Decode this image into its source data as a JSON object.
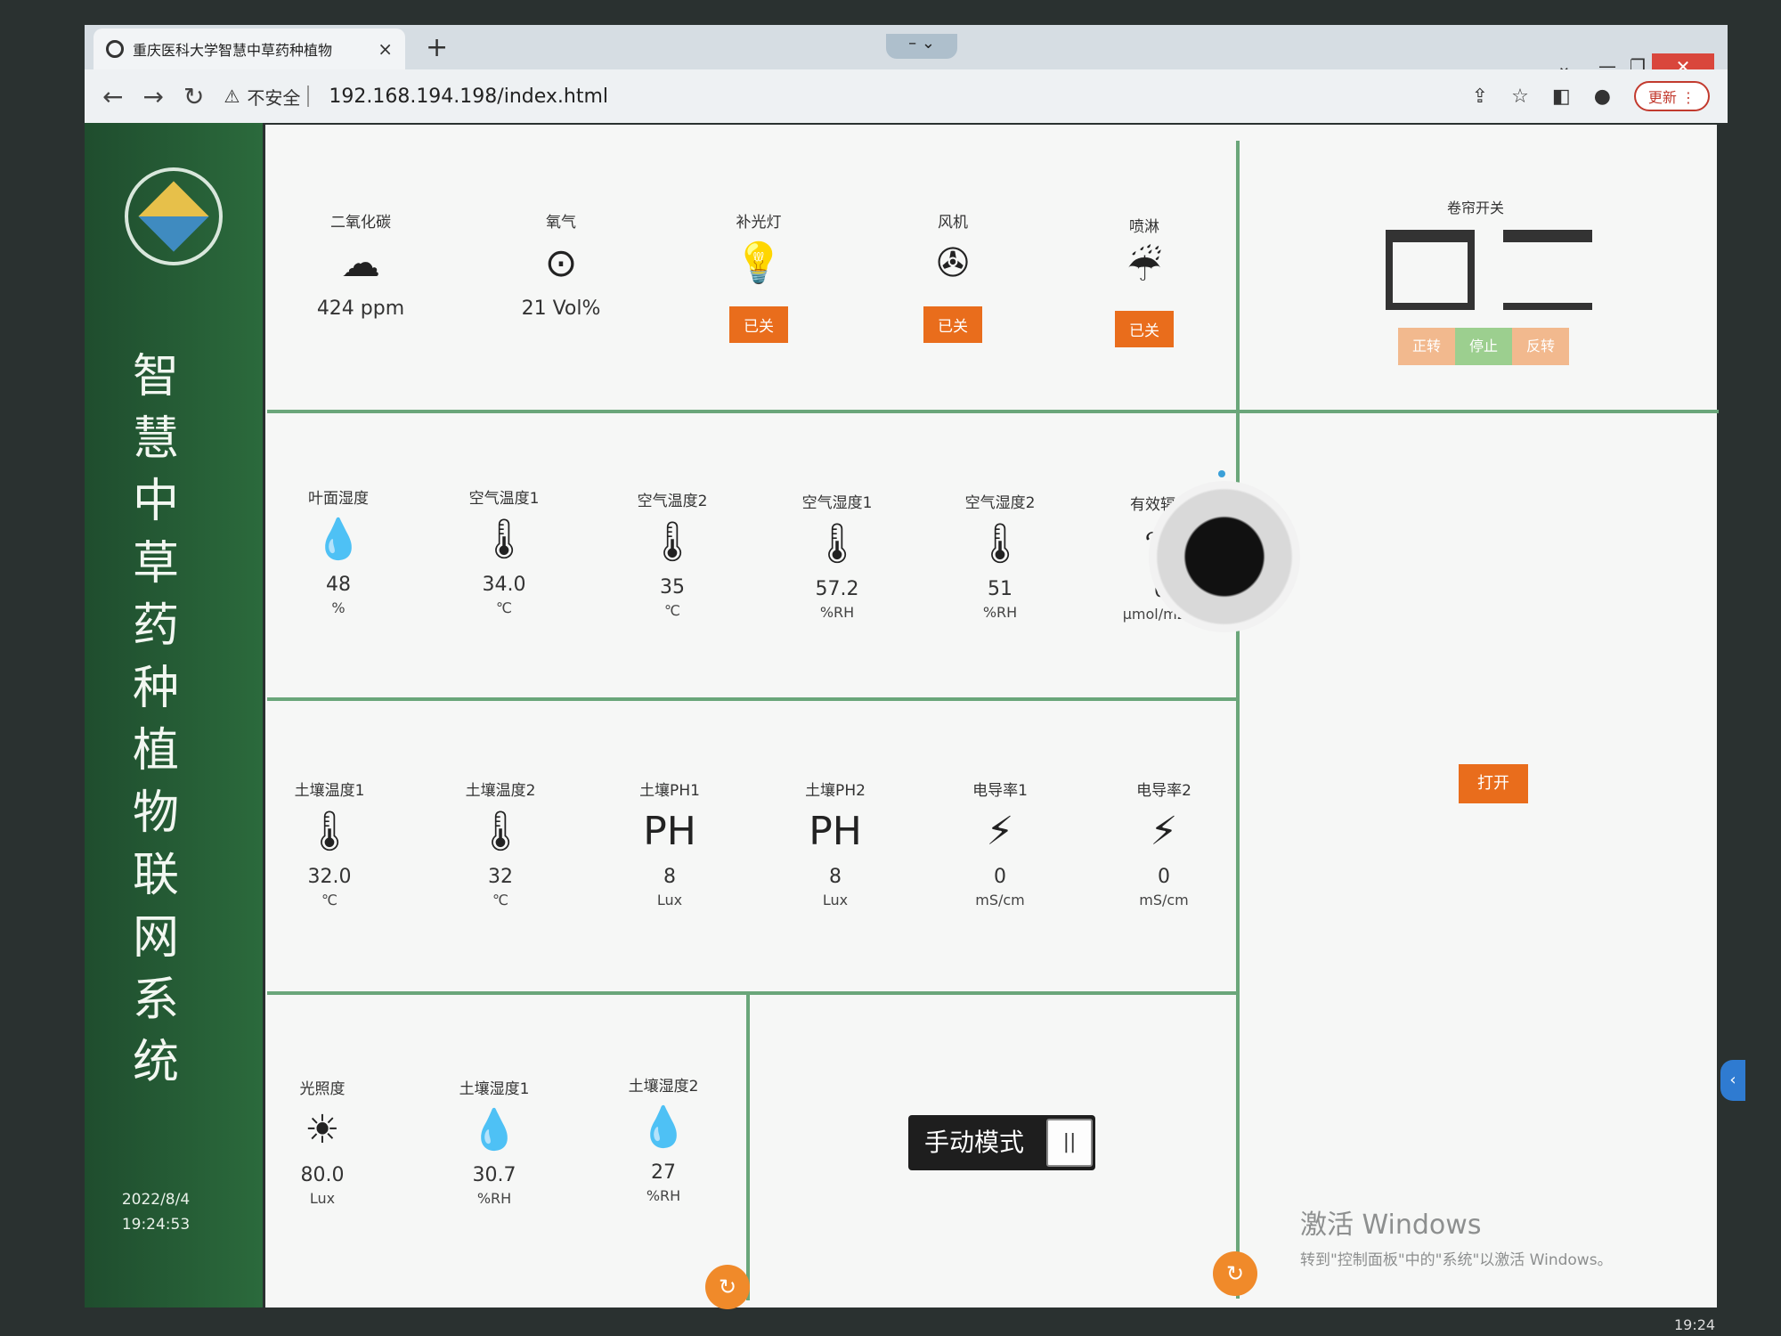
{
  "browser": {
    "tab_title": "重庆医科大学智慧中草药种植物",
    "tab_close": "×",
    "new_tab": "+",
    "address_security": "不安全",
    "address_url": "192.168.194.198/index.html",
    "update_label": "更新"
  },
  "sidebar": {
    "title": "智慧中草药种植物联网系统",
    "date": "2022/8/4",
    "time": "19:24:53"
  },
  "row1": {
    "co2": {
      "label": "二氧化碳",
      "icon": "☁",
      "value": "424 ppm"
    },
    "o2": {
      "label": "氧气",
      "icon": "⊙",
      "value": "21 Vol%"
    },
    "light": {
      "label": "补光灯",
      "icon": "💡",
      "status": "已关"
    },
    "fan": {
      "label": "风机",
      "icon": "✇",
      "status": "已关"
    },
    "spray": {
      "label": "喷淋",
      "icon": "☔",
      "status": "已关"
    }
  },
  "curtain": {
    "title": "卷帘开关",
    "buttons": [
      "正转",
      "停止",
      "反转"
    ]
  },
  "row2": [
    {
      "label": "叶面湿度",
      "icon": "💧",
      "value": "48",
      "unit": "%"
    },
    {
      "label": "空气温度1",
      "icon": "🌡",
      "value": "34.0",
      "unit": "℃"
    },
    {
      "label": "空气温度2",
      "icon": "🌡",
      "value": "35",
      "unit": "℃"
    },
    {
      "label": "空气湿度1",
      "icon": "🌡",
      "value": "57.2",
      "unit": "%RH"
    },
    {
      "label": "空气湿度2",
      "icon": "🌡",
      "value": "51",
      "unit": "%RH"
    },
    {
      "label": "有效辐射",
      "icon": "❦",
      "value": "0",
      "unit": "μmol/m2·s"
    }
  ],
  "row3": [
    {
      "label": "土壤温度1",
      "icon": "🌡",
      "value": "32.0",
      "unit": "℃"
    },
    {
      "label": "土壤温度2",
      "icon": "🌡",
      "value": "32",
      "unit": "℃"
    },
    {
      "label": "土壤PH1",
      "icon": "PH",
      "value": "8",
      "unit": "Lux"
    },
    {
      "label": "土壤PH2",
      "icon": "PH",
      "value": "8",
      "unit": "Lux"
    },
    {
      "label": "电导率1",
      "icon": "⚡",
      "value": "0",
      "unit": "mS/cm"
    },
    {
      "label": "电导率2",
      "icon": "⚡",
      "value": "0",
      "unit": "mS/cm"
    }
  ],
  "row4": [
    {
      "label": "光照度",
      "icon": "☀",
      "value": "80.0",
      "unit": "Lux"
    },
    {
      "label": "土壤湿度1",
      "icon": "💧",
      "value": "30.7",
      "unit": "%RH"
    },
    {
      "label": "土壤湿度2",
      "icon": "💧",
      "value": "27",
      "unit": "%RH"
    }
  ],
  "camera": {
    "open_label": "打开"
  },
  "mode": {
    "label": "手动模式",
    "knob": "||"
  },
  "windows": {
    "activate_title": "激活 Windows",
    "activate_sub": "转到\"控制面板\"中的\"系统\"以激活 Windows。",
    "taskbar_time": "19:24"
  },
  "colors": {
    "accent": "#e96d1c",
    "sidebar": "#2b6a3c",
    "grid_line": "#6aa67a"
  }
}
